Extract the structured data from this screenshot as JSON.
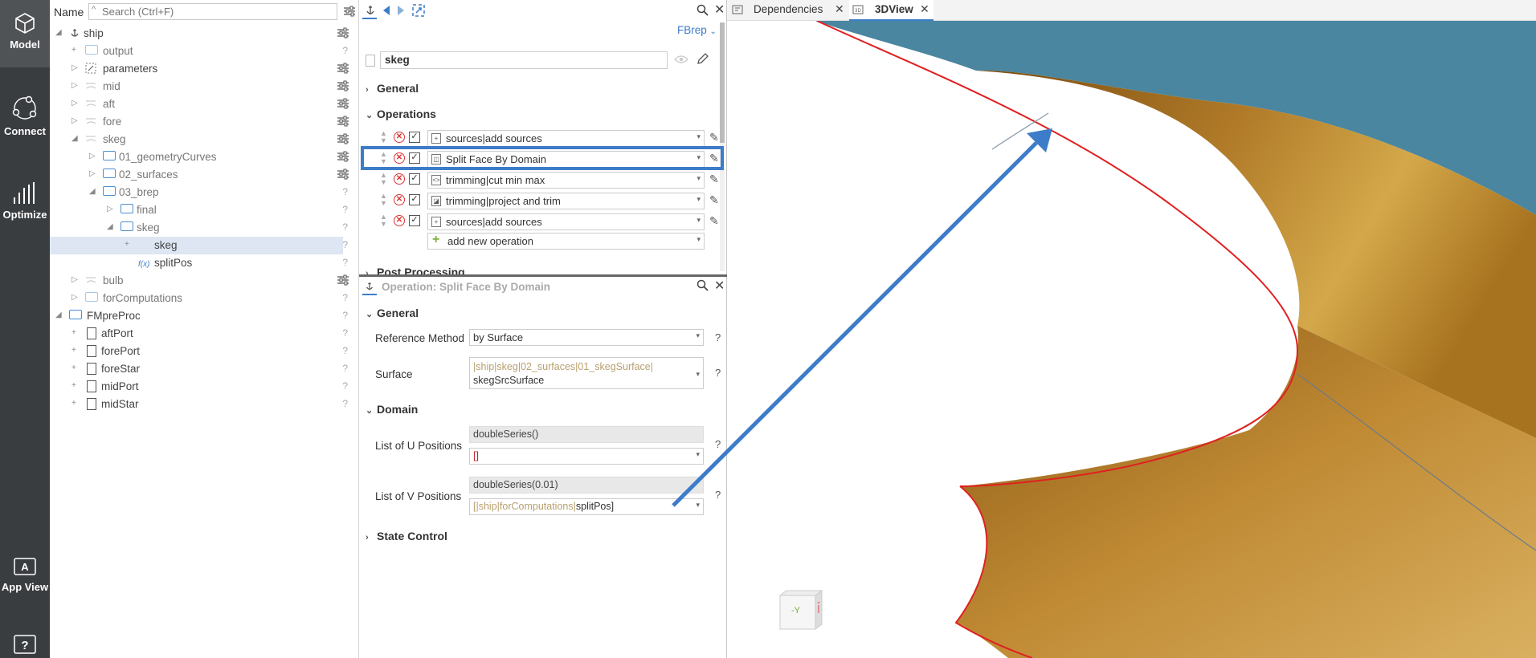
{
  "leftbar": {
    "items": [
      {
        "label": "Model",
        "icon": "cube-icon"
      },
      {
        "label": "Connect",
        "icon": "connect-icon"
      },
      {
        "label": "Optimize",
        "icon": "chart-icon"
      },
      {
        "label": "App View",
        "icon": "app-view-icon"
      }
    ],
    "help": "?"
  },
  "tree": {
    "name_label": "Name",
    "search_placeholder": "Search (Ctrl+F)",
    "rows": [
      {
        "label": "ship"
      },
      {
        "label": "output"
      },
      {
        "label": "parameters"
      },
      {
        "label": "mid"
      },
      {
        "label": "aft"
      },
      {
        "label": "fore"
      },
      {
        "label": "skeg"
      },
      {
        "label": "01_geometryCurves"
      },
      {
        "label": "02_surfaces"
      },
      {
        "label": "03_brep"
      },
      {
        "label": "final"
      },
      {
        "label": "skeg"
      },
      {
        "label": "skeg"
      },
      {
        "label": "splitPos",
        "prefix": "f(x)"
      },
      {
        "label": "bulb"
      },
      {
        "label": "forComputations"
      },
      {
        "label": "FMpreProc"
      },
      {
        "label": "aftPort"
      },
      {
        "label": "forePort"
      },
      {
        "label": "foreStar"
      },
      {
        "label": "midPort"
      },
      {
        "label": "midStar"
      }
    ]
  },
  "object_editor": {
    "type_label": "FBrep",
    "name_value": "skeg",
    "general_label": "General",
    "operations_label": "Operations",
    "operations": [
      {
        "label": "sources|add sources",
        "icon": "+"
      },
      {
        "label": "Split Face By Domain",
        "icon": "◫"
      },
      {
        "label": "trimming|cut min max",
        "icon": "<>"
      },
      {
        "label": "trimming|project and trim",
        "icon": "◪"
      },
      {
        "label": "sources|add sources",
        "icon": "+"
      }
    ],
    "add_new_operation": "add new operation",
    "post_processing_label": "Post Processing"
  },
  "operation_editor": {
    "title": "Operation: Split Face By Domain",
    "general_label": "General",
    "reference_method_label": "Reference Method",
    "reference_method_value": "by Surface",
    "surface_label": "Surface",
    "surface_path": "|ship|skeg|02_surfaces|01_skegSurface|",
    "surface_name": "skegSrcSurface",
    "domain_label": "Domain",
    "u_label": "List of U Positions",
    "u_expr": "doubleSeries()",
    "u_value": "[]",
    "v_label": "List of V Positions",
    "v_expr": "doubleSeries(0.01)",
    "v_value_prefix": "[|ship|forComputations|",
    "v_value_name": "splitPos]",
    "state_control_label": "State Control",
    "help": "?"
  },
  "view_tabs": [
    {
      "label": "Dependencies"
    },
    {
      "label": "3DView"
    }
  ],
  "view": {
    "cube_label": "-Y",
    "colors": {
      "sky": "#4a86a0",
      "hull": "#b07a28",
      "edge": "#e02020",
      "annotation": "#3d7cc8"
    }
  }
}
